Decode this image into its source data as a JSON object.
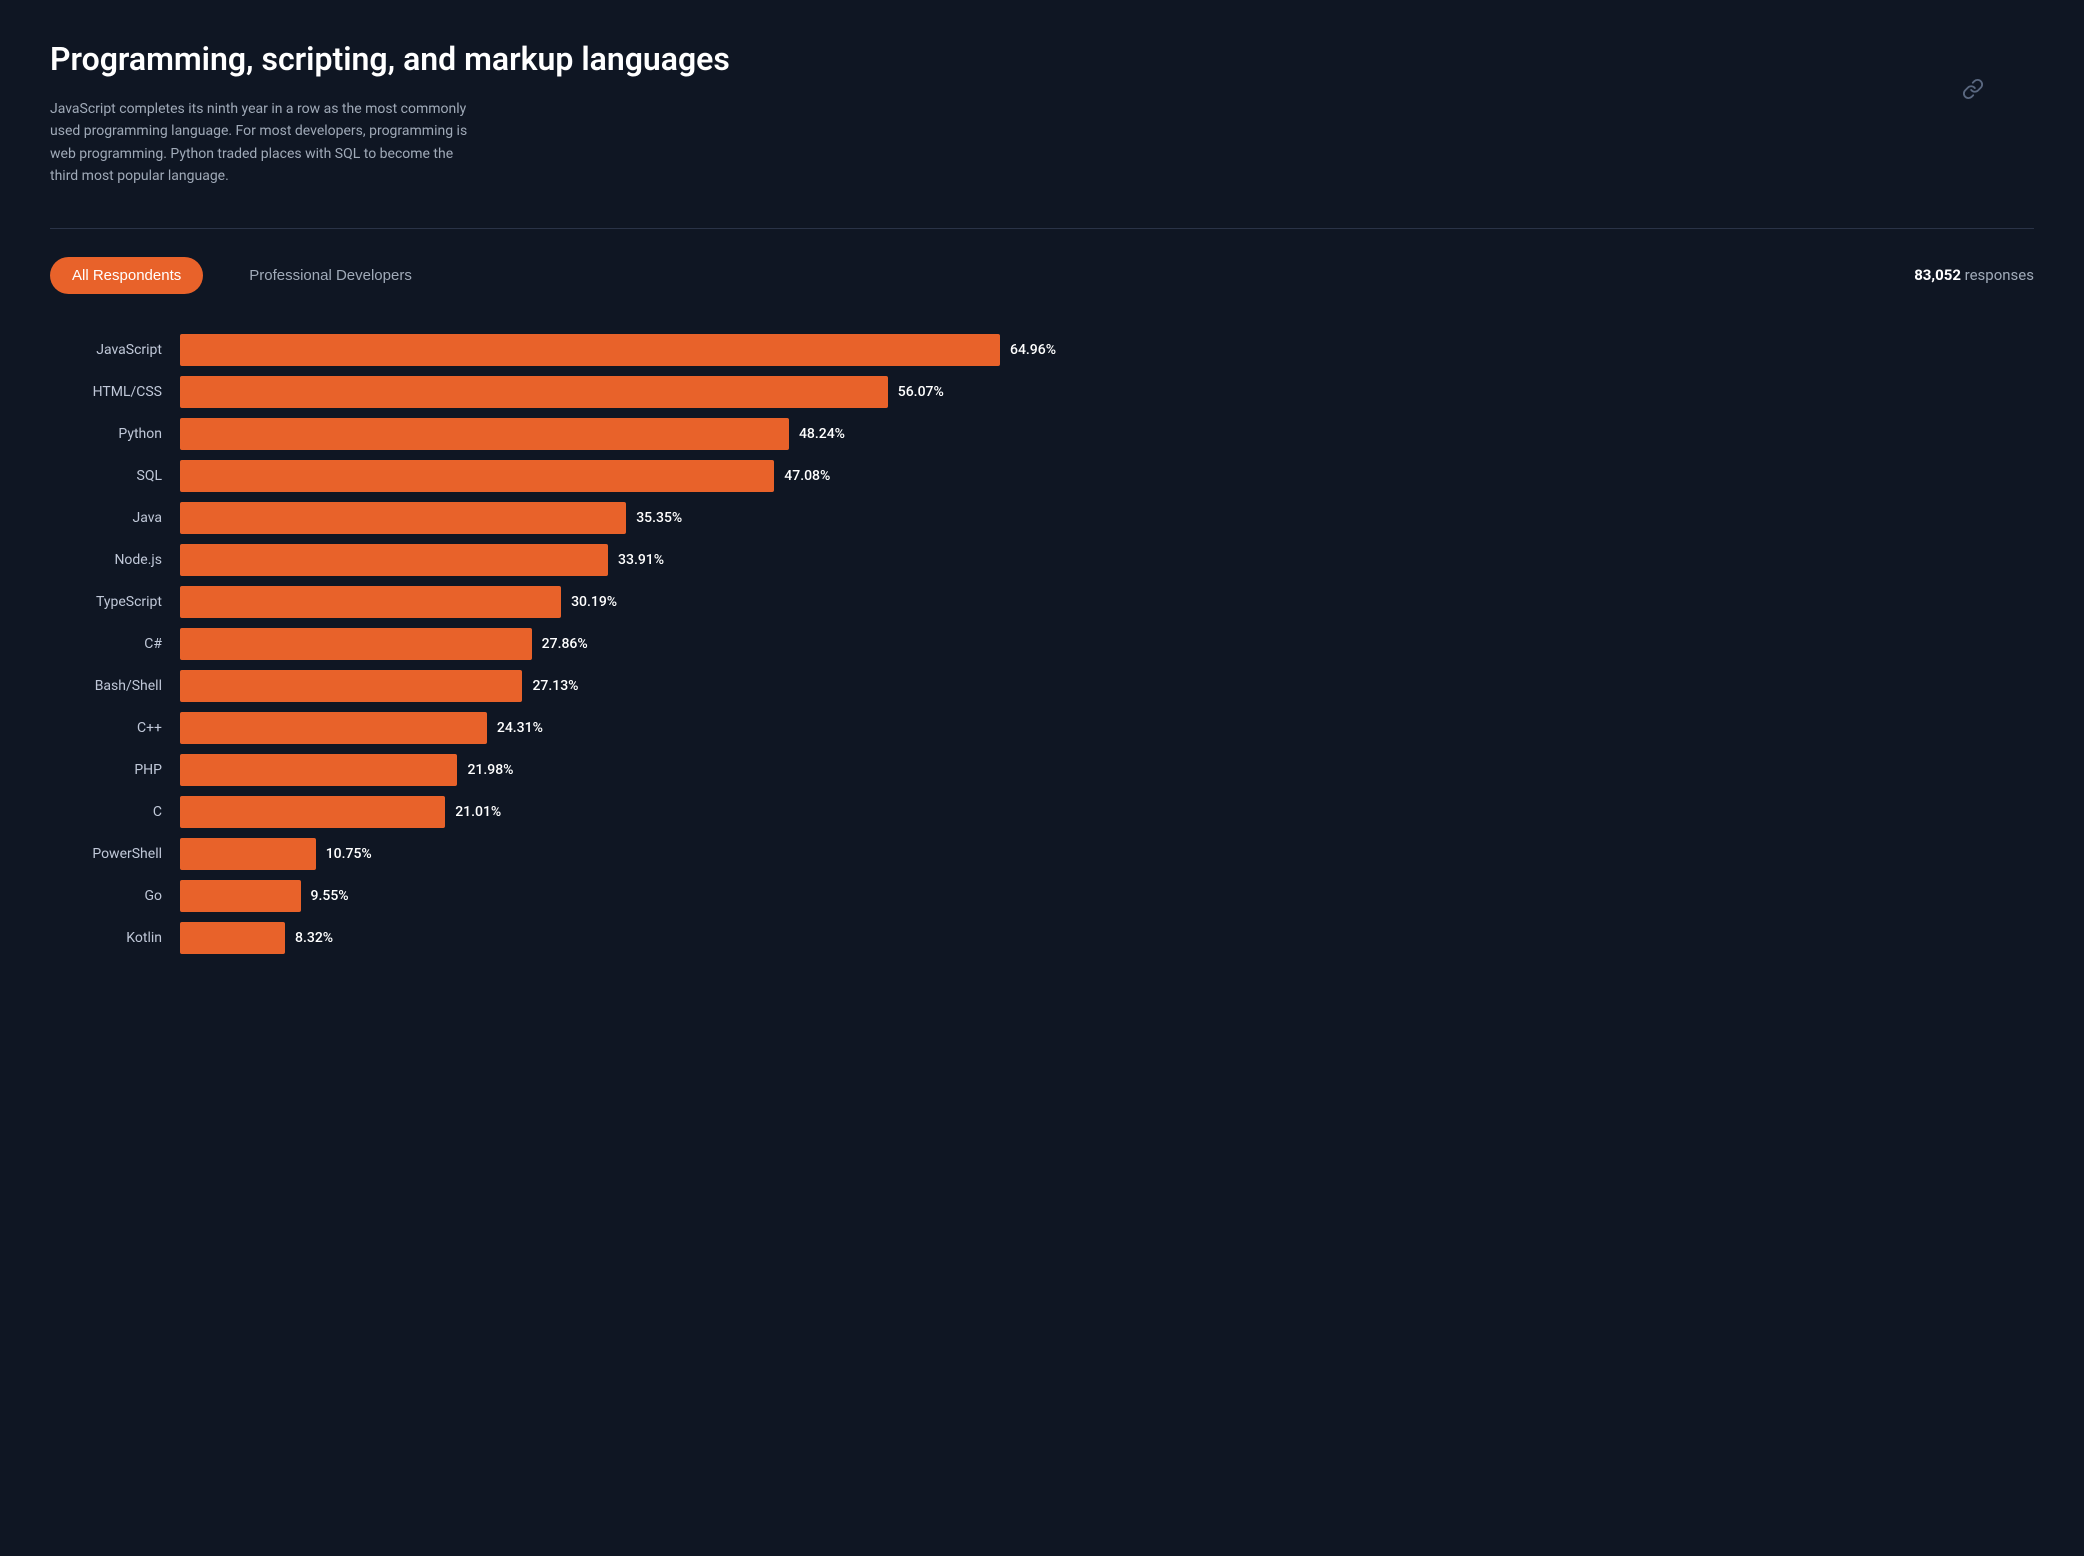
{
  "header": {
    "title": "Programming, scripting, and markup languages",
    "description": "JavaScript completes its ninth year in a row as the most commonly used programming language. For most developers, programming is web programming. Python traded places with SQL to become the third most popular language.",
    "link_icon": "🔗"
  },
  "filters": {
    "tabs": [
      {
        "id": "all",
        "label": "All Respondents",
        "active": true
      },
      {
        "id": "pro",
        "label": "Professional Developers",
        "active": false
      }
    ],
    "responses_prefix": "83,052",
    "responses_suffix": " responses"
  },
  "chart": {
    "max_pct": 64.96,
    "bars": [
      {
        "label": "JavaScript",
        "pct": 64.96
      },
      {
        "label": "HTML/CSS",
        "pct": 56.07
      },
      {
        "label": "Python",
        "pct": 48.24
      },
      {
        "label": "SQL",
        "pct": 47.08
      },
      {
        "label": "Java",
        "pct": 35.35
      },
      {
        "label": "Node.js",
        "pct": 33.91
      },
      {
        "label": "TypeScript",
        "pct": 30.19
      },
      {
        "label": "C#",
        "pct": 27.86
      },
      {
        "label": "Bash/Shell",
        "pct": 27.13
      },
      {
        "label": "C++",
        "pct": 24.31
      },
      {
        "label": "PHP",
        "pct": 21.98
      },
      {
        "label": "C",
        "pct": 21.01
      },
      {
        "label": "PowerShell",
        "pct": 10.75
      },
      {
        "label": "Go",
        "pct": 9.55
      },
      {
        "label": "Kotlin",
        "pct": 8.32
      }
    ]
  }
}
